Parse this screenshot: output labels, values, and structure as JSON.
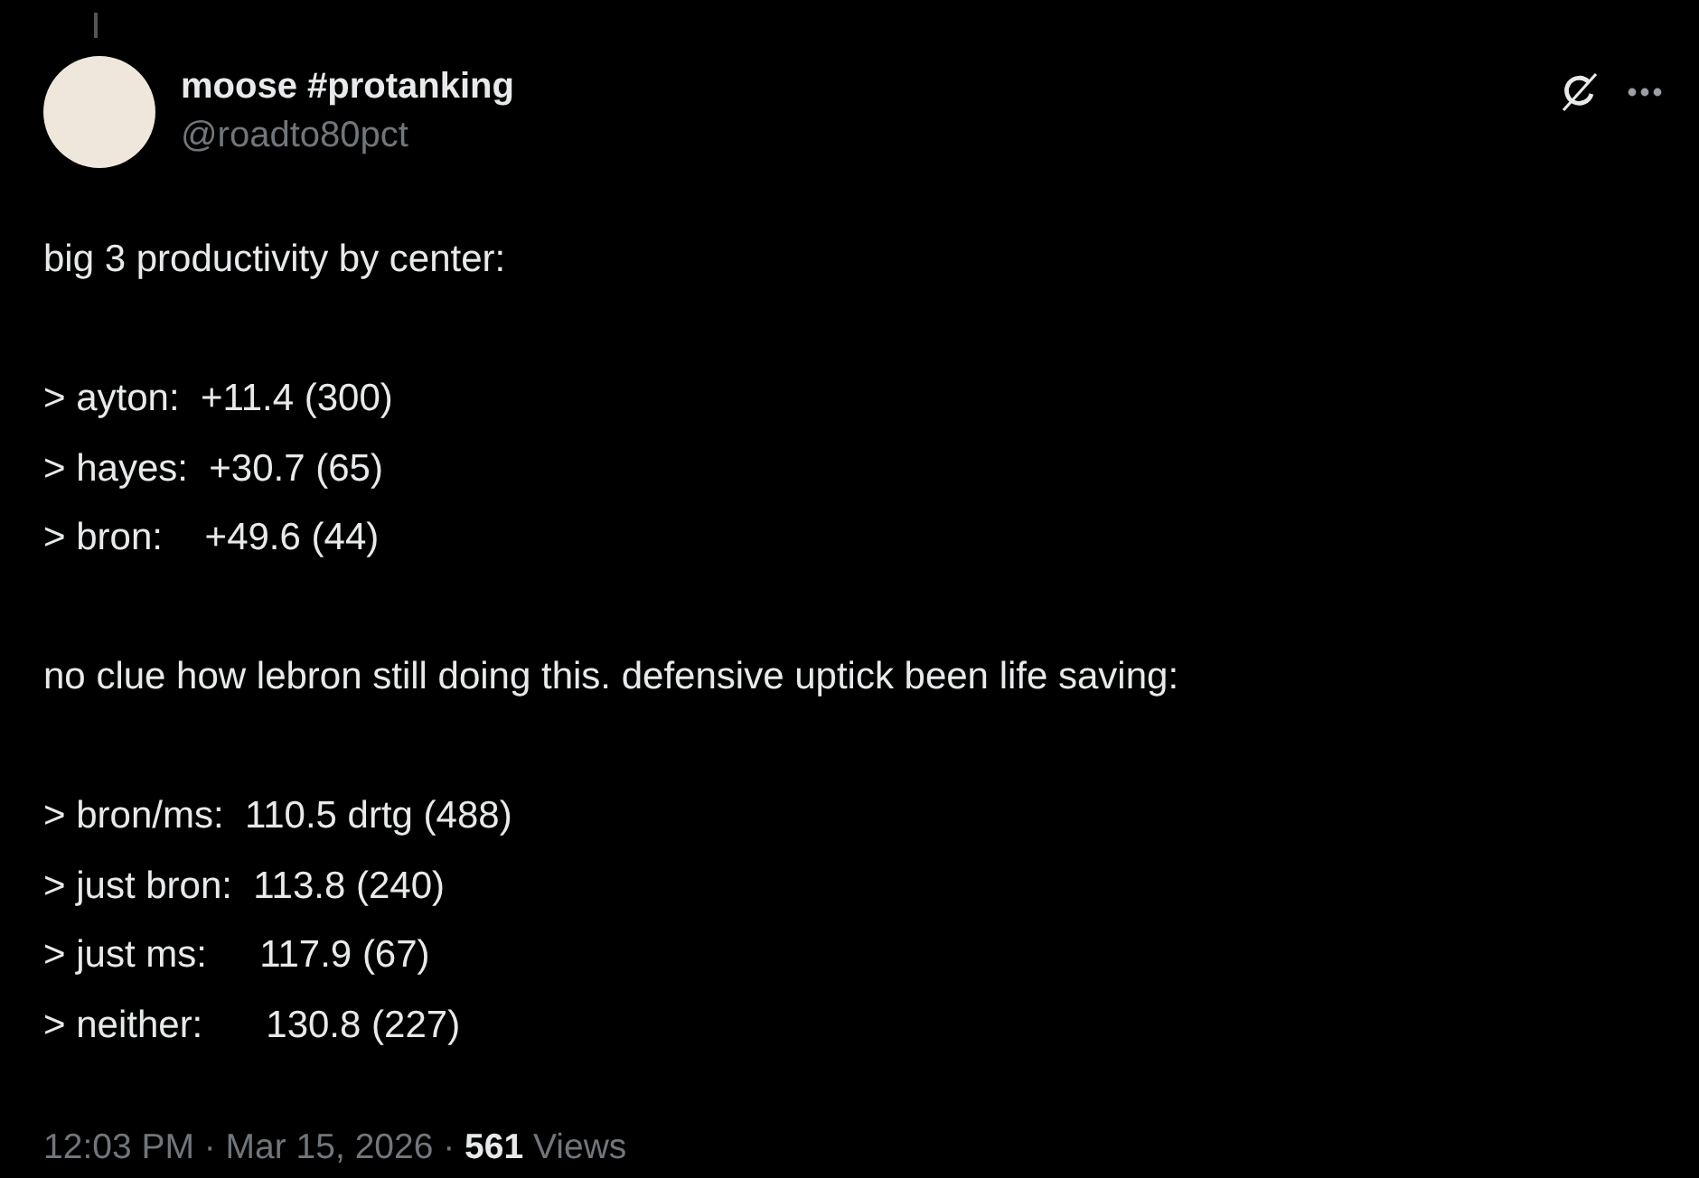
{
  "post": {
    "author": {
      "name": "moose #protanking",
      "handle": "@roadto80pct"
    },
    "body": [
      [
        "big 3 productivity by center:"
      ],
      [
        "> ayton:  +11.4 (300)",
        "> hayes:  +30.7 (65)",
        "> bron:    +49.6 (44)"
      ],
      [
        "no clue how lebron still doing this. defensive uptick been life saving:"
      ],
      [
        "> bron/ms:  110.5 drtg (488)",
        "> just bron:  113.8 (240)",
        "> just ms:     117.9 (67)",
        "> neither:      130.8 (227)"
      ]
    ],
    "meta": "12:03 PM · Mar 15, 2026 · **561** Views"
  }
}
